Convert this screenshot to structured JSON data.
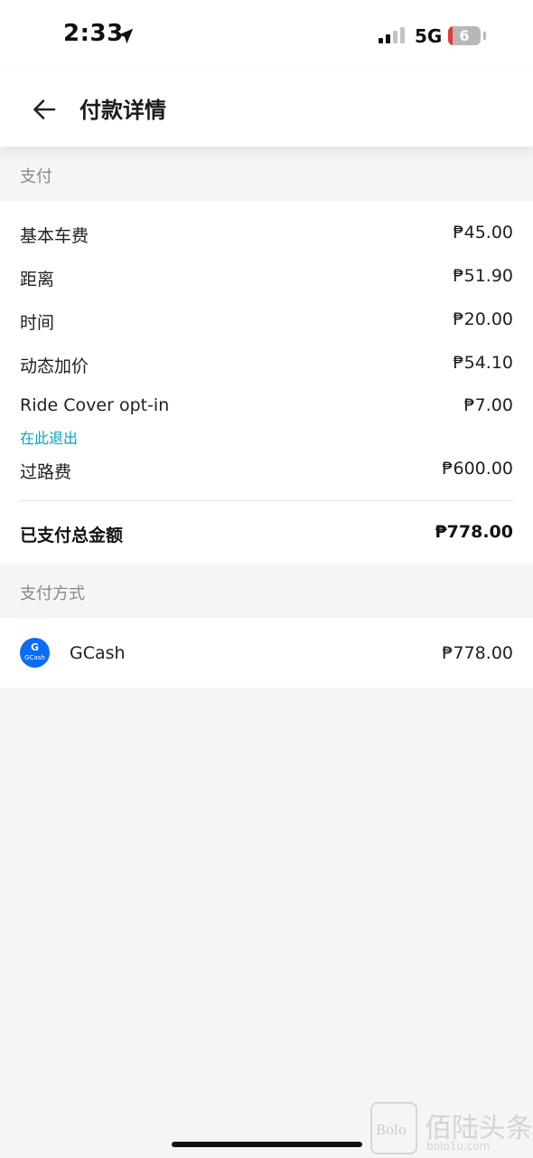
{
  "status_bar": {
    "time": "2:33",
    "network": "5G",
    "battery": "6",
    "location_icon": "location-arrow-icon",
    "signal_icon": "signal-bars-icon"
  },
  "header": {
    "back_icon": "back-arrow-icon",
    "title": "付款详情"
  },
  "payment_section": {
    "label": "支付",
    "items": [
      {
        "label": "基本车费",
        "amount": "₱45.00"
      },
      {
        "label": "距离",
        "amount": "₱51.90"
      },
      {
        "label": "时间",
        "amount": "₱20.00"
      },
      {
        "label": "动态加价",
        "amount": "₱54.10"
      },
      {
        "label": "Ride Cover opt-in",
        "amount": "₱7.00",
        "link": "在此退出"
      },
      {
        "label": "过路费",
        "amount": "₱600.00"
      }
    ],
    "total_label": "已支付总金额",
    "total_amount": "₱778.00"
  },
  "payment_method_section": {
    "label": "支付方式",
    "method": {
      "icon": "gcash-icon",
      "icon_letter": "G",
      "icon_caption": "GCash",
      "name": "GCash",
      "amount": "₱778.00"
    }
  },
  "watermark": {
    "badge": "Bolo",
    "text": "佰陆头条",
    "sub": "bolo1u.com"
  },
  "colors": {
    "link": "#00a5c8",
    "background": "#f5f5f5",
    "gcash_blue": "#0a6cf5"
  }
}
